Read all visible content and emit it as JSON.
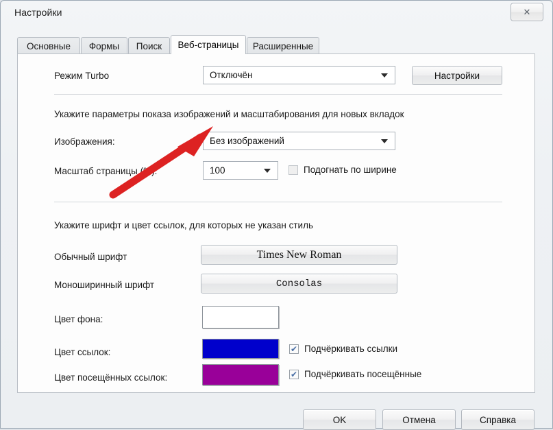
{
  "window": {
    "title": "Настройки",
    "close_icon": "close-icon",
    "close_glyph": "✕"
  },
  "tabs": [
    {
      "label": "Основные",
      "active": false
    },
    {
      "label": "Формы",
      "active": false
    },
    {
      "label": "Поиск",
      "active": false
    },
    {
      "label": "Веб-страницы",
      "active": true
    },
    {
      "label": "Расширенные",
      "active": false
    }
  ],
  "form": {
    "turbo_label": "Режим Turbo",
    "turbo_value": "Отключён",
    "turbo_settings_button": "Настройки",
    "images_section_hint": "Укажите параметры показа изображений и масштабирования для новых вкладок",
    "images_label": "Изображения:",
    "images_value": "Без изображений",
    "scale_label": "Масштаб страницы (%):",
    "scale_value": "100",
    "fit_width_label": "Подогнать по ширине",
    "fit_width_checked": false,
    "fonts_section_hint": "Укажите шрифт и цвет ссылок, для которых не указан стиль",
    "normal_font_label": "Обычный шрифт",
    "normal_font_value": "Times New Roman",
    "mono_font_label": "Моноширинный шрифт",
    "mono_font_value": "Consolas",
    "bg_color_label": "Цвет фона:",
    "bg_color_value": "#ffffff",
    "link_color_label": "Цвет ссылок:",
    "link_color_value": "#0000cc",
    "visited_color_label": "Цвет посещённых ссылок:",
    "visited_color_value": "#990099",
    "underline_links_label": "Подчёркивать ссылки",
    "underline_links_checked": true,
    "underline_visited_label": "Подчёркивать посещённые",
    "underline_visited_checked": true,
    "checkmark_glyph": "✔"
  },
  "footer": {
    "ok": "OK",
    "cancel": "Отмена",
    "help": "Справка"
  },
  "annotation": {
    "arrow_icon": "red-arrow-icon",
    "arrow_color": "#dd2222"
  }
}
